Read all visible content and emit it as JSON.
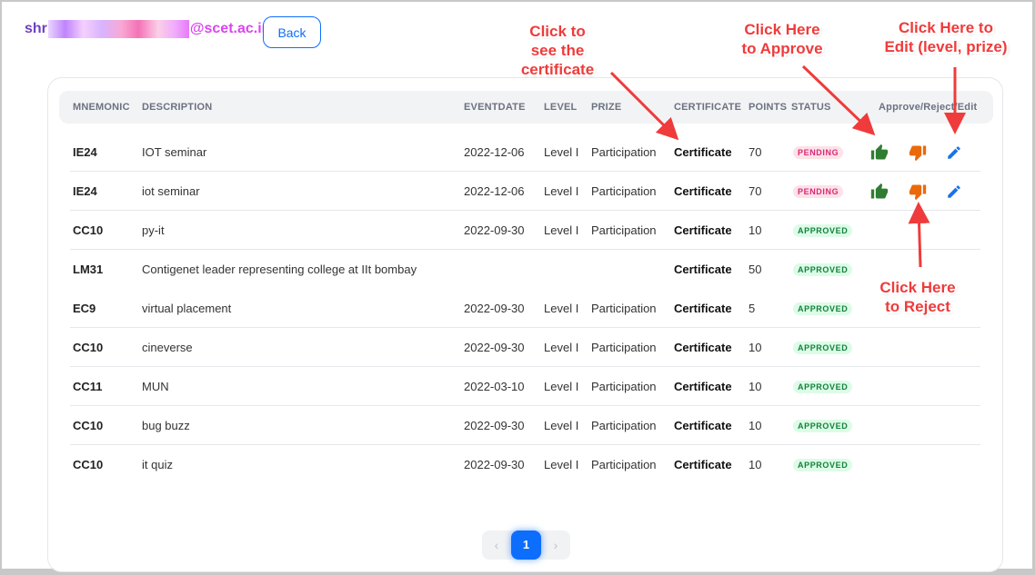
{
  "header": {
    "email_prefix": "shr",
    "email_domain": "@scet.ac.in",
    "back_label": "Back"
  },
  "table": {
    "columns": [
      "MNEMONIC",
      "DESCRIPTION",
      "EVENTDATE",
      "LEVEL",
      "PRIZE",
      "CERTIFICATE",
      "POINTS",
      "STATUS",
      "Approve/Reject/Edit"
    ],
    "rows": [
      {
        "mnemonic": "IE24",
        "description": "IOT seminar",
        "date": "2022-12-06",
        "level": "Level I",
        "prize": "Participation",
        "certificate": "Certificate",
        "points": "70",
        "status": "PENDING"
      },
      {
        "mnemonic": "IE24",
        "description": "iot seminar",
        "date": "2022-12-06",
        "level": "Level I",
        "prize": "Participation",
        "certificate": "Certificate",
        "points": "70",
        "status": "PENDING"
      },
      {
        "mnemonic": "CC10",
        "description": "py-it",
        "date": "2022-09-30",
        "level": "Level I",
        "prize": "Participation",
        "certificate": "Certificate",
        "points": "10",
        "status": "APPROVED"
      },
      {
        "mnemonic": "LM31",
        "description": "Contigenet leader representing college at IIt bombay",
        "date": "",
        "level": "",
        "prize": "",
        "certificate": "Certificate",
        "points": "50",
        "status": "APPROVED"
      },
      {
        "mnemonic": "EC9",
        "description": "virtual placement",
        "date": "2022-09-30",
        "level": "Level I",
        "prize": "Participation",
        "certificate": "Certificate",
        "points": "5",
        "status": "APPROVED"
      },
      {
        "mnemonic": "CC10",
        "description": "cineverse",
        "date": "2022-09-30",
        "level": "Level I",
        "prize": "Participation",
        "certificate": "Certificate",
        "points": "10",
        "status": "APPROVED"
      },
      {
        "mnemonic": "CC11",
        "description": "MUN",
        "date": "2022-03-10",
        "level": "Level I",
        "prize": "Participation",
        "certificate": "Certificate",
        "points": "10",
        "status": "APPROVED"
      },
      {
        "mnemonic": "CC10",
        "description": "bug buzz",
        "date": "2022-09-30",
        "level": "Level I",
        "prize": "Participation",
        "certificate": "Certificate",
        "points": "10",
        "status": "APPROVED"
      },
      {
        "mnemonic": "CC10",
        "description": "it quiz",
        "date": "2022-09-30",
        "level": "Level I",
        "prize": "Participation",
        "certificate": "Certificate",
        "points": "10",
        "status": "APPROVED"
      }
    ]
  },
  "pagination": {
    "prev": "‹",
    "current": "1",
    "next": "›"
  },
  "annotations": {
    "certificate": [
      "Click to",
      "see the",
      "certificate"
    ],
    "approve": [
      "Click Here",
      "to Approve"
    ],
    "edit": [
      "Click Here to",
      "Edit (level, prize)"
    ],
    "reject": [
      "Click Here",
      "to Reject"
    ]
  },
  "colors": {
    "approve_icon": "#2e7d32",
    "reject_icon": "#ea6a0a",
    "edit_icon": "#1a73e8",
    "accent": "#0d6efd",
    "annotation": "#ef3b3b"
  },
  "icons": {
    "approve": "thumbs-up-icon",
    "reject": "thumbs-down-icon",
    "edit": "pencil-icon"
  }
}
